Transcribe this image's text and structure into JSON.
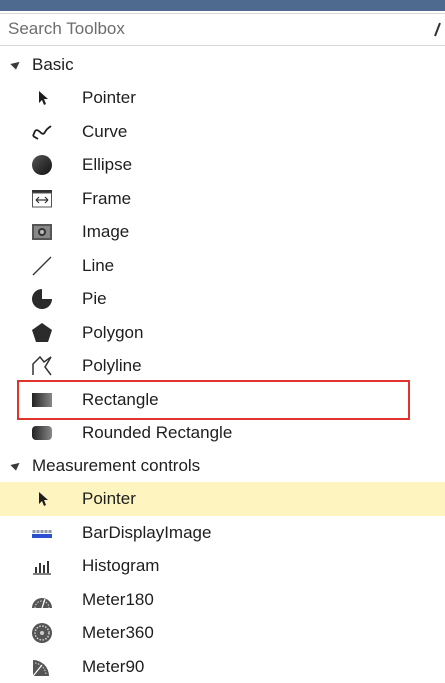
{
  "search": {
    "placeholder": "Search Toolbox",
    "icon": "search-icon"
  },
  "groups": [
    {
      "label": "Basic",
      "items": [
        {
          "label": "Pointer",
          "icon": "pointer-icon"
        },
        {
          "label": "Curve",
          "icon": "curve-icon"
        },
        {
          "label": "Ellipse",
          "icon": "ellipse-icon"
        },
        {
          "label": "Frame",
          "icon": "frame-icon"
        },
        {
          "label": "Image",
          "icon": "image-icon"
        },
        {
          "label": "Line",
          "icon": "line-icon"
        },
        {
          "label": "Pie",
          "icon": "pie-icon"
        },
        {
          "label": "Polygon",
          "icon": "polygon-icon"
        },
        {
          "label": "Polyline",
          "icon": "polyline-icon"
        },
        {
          "label": "Rectangle",
          "icon": "rectangle-icon"
        },
        {
          "label": "Rounded Rectangle",
          "icon": "rounded-rectangle-icon"
        }
      ]
    },
    {
      "label": "Measurement controls",
      "items": [
        {
          "label": "Pointer",
          "icon": "pointer-icon"
        },
        {
          "label": "BarDisplayImage",
          "icon": "bar-display-image-icon"
        },
        {
          "label": "Histogram",
          "icon": "histogram-icon"
        },
        {
          "label": "Meter180",
          "icon": "meter180-icon"
        },
        {
          "label": "Meter360",
          "icon": "meter360-icon"
        },
        {
          "label": "Meter90",
          "icon": "meter90-icon"
        }
      ]
    }
  ],
  "colors": {
    "selection": "#fdf4bf",
    "highlight_box": "#e0322f",
    "title_bar": "#4f6a8f"
  }
}
